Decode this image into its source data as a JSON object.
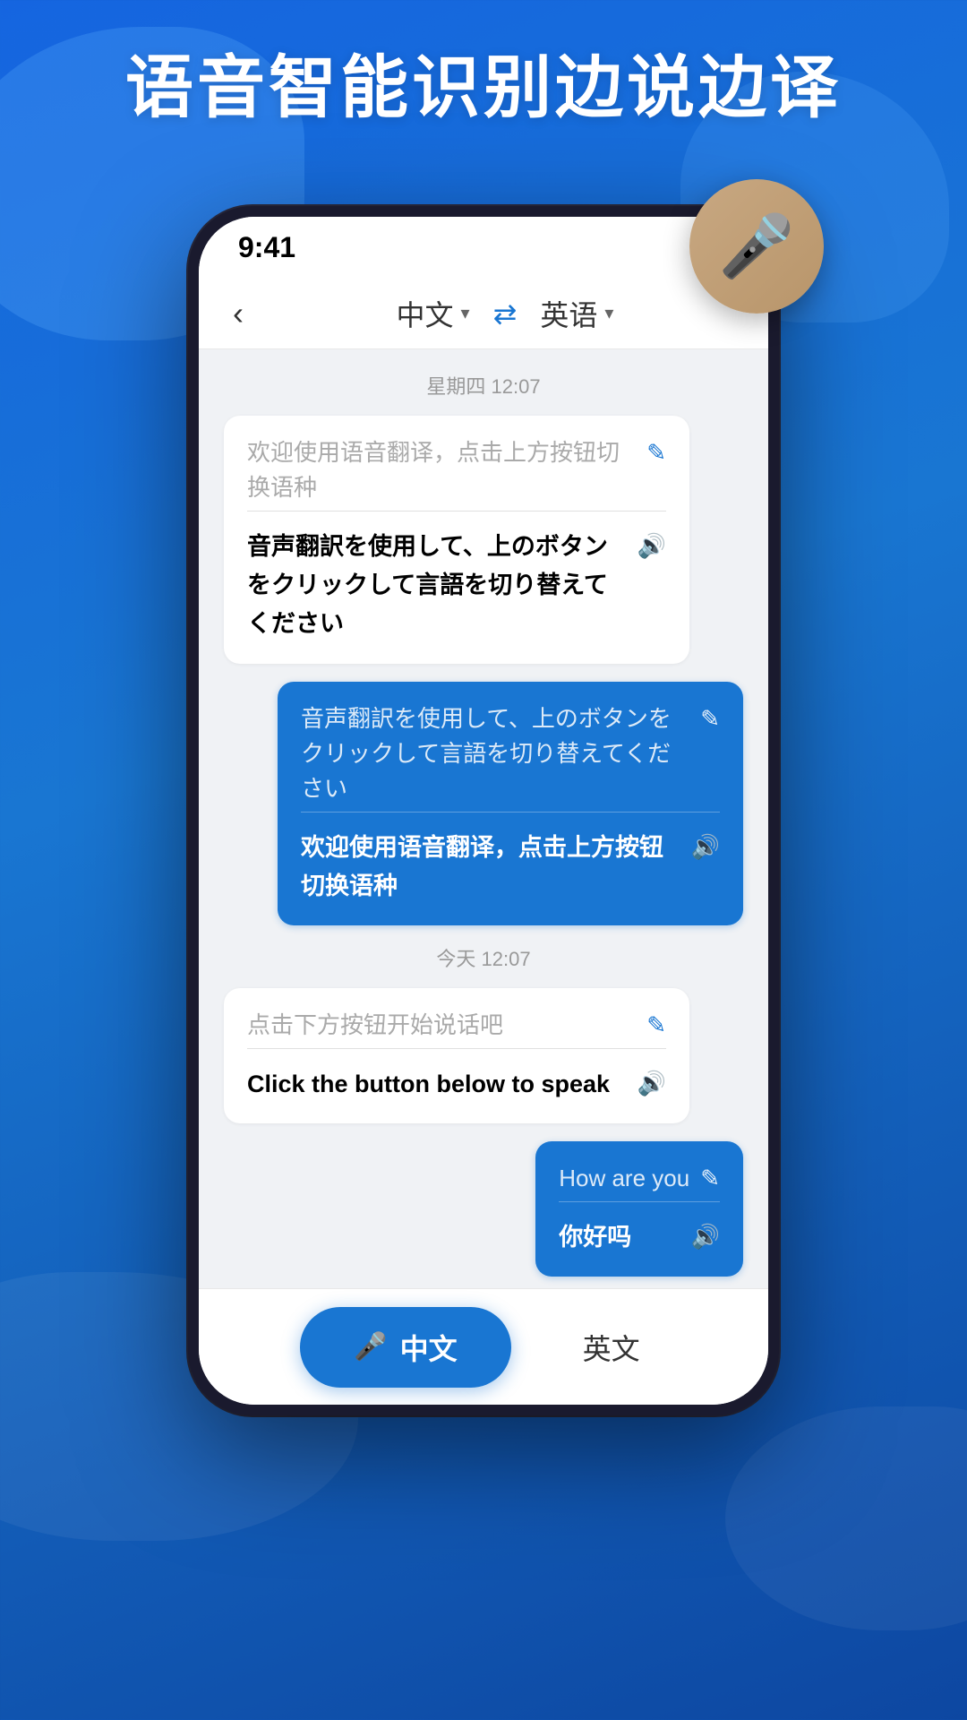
{
  "hero": {
    "title": "语音智能识别边说边译"
  },
  "phone": {
    "status": {
      "time": "9:41"
    },
    "nav": {
      "back_label": "‹",
      "lang_left": "中文",
      "lang_right": "英语",
      "swap_icon": "⇄"
    },
    "chat": {
      "timestamp1": "星期四 12:07",
      "timestamp2": "今天 12:07",
      "bubble1_original": "欢迎使用语音翻译，点击上方按钮切换语种",
      "bubble1_translated": "音声翻訳を使用して、上のボタンをクリックして言語を切り替えてください",
      "bubble2_original": "音声翻訳を使用して、上のボタンをクリックして言語を切り替えてください",
      "bubble2_translated": "欢迎使用语音翻译，点击上方按钮切换语种",
      "bubble3_original": "点击下方按钮开始说话吧",
      "bubble3_translated": "Click the button below to speak",
      "bubble4_original": "How are you",
      "bubble4_translated": "你好吗"
    },
    "bottom_bar": {
      "btn_chinese_label": "中文",
      "btn_english_label": "英文",
      "mic_icon": "🎤"
    }
  }
}
